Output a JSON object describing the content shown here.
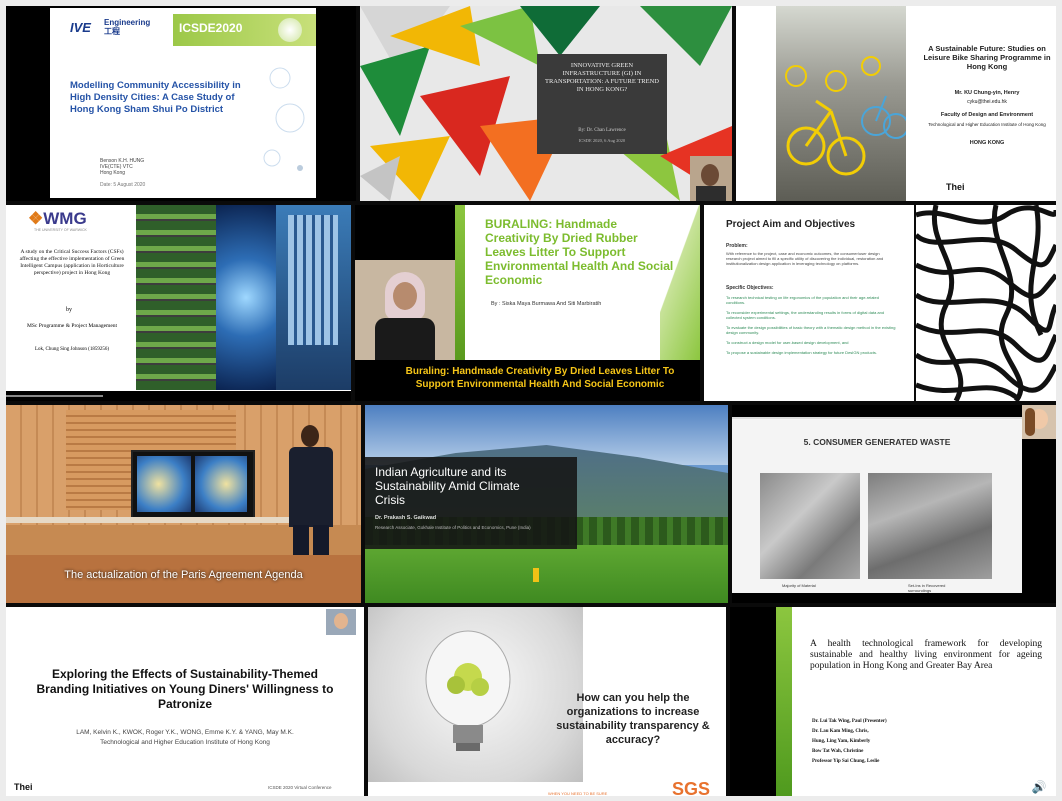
{
  "tiles": {
    "t1": {
      "logo_ive": "IVE",
      "logo_eng": "Engineering",
      "logo_sub": "工程",
      "banner": "ICSDE2020",
      "title": "Modelling Community Accessibility in High Density Cities: A Case Study of Hong Kong Sham Shui Po District",
      "author_lines": [
        "Benson K.H. HUNG",
        "IVE(CTE) VTC",
        "Hong Kong"
      ],
      "date": "Date: 5 August 2020"
    },
    "t2": {
      "title": "INNOVATIVE GREEN INFRASTRUCTURE (GI) IN TRANSPORTATION: A FUTURE TREND IN HONG KONG?",
      "byline": "By: Dr. Chan Lawrence",
      "date": "ICSDE 2020, 6 Aug 2020"
    },
    "t3": {
      "title": "A Sustainable Future: Studies on Leisure Bike Sharing Programme in Hong Kong",
      "author": "Mr. KU Chung-yin, Henry",
      "email": "cyku@thei.edu.hk",
      "faculty": "Faculty of Design and Environment",
      "institute": "Technological and Higher Education Institute of Hong Kong",
      "place": "HONG KONG",
      "logo": "Thei"
    },
    "t4": {
      "logo": "WMG",
      "logo_sub": "THE UNIVERSITY OF WARWICK",
      "title": "A study on the Critical Success Factors (CSFs) affecting the effective implementation of Green Intelligent Campus (application in Horticulture perspective) project in Hong Kong",
      "by": "by",
      "programme": "MSc Programme & Project Management",
      "student": "Lok, Chung Sing Johnson (1859256)"
    },
    "t5": {
      "title": "BURALING: Handmade Creativity By Dried Rubber Leaves Litter To Support Environmental Health And Social Economic",
      "authors": "By : Siska Maya Burmawa And Siti Marbiratih",
      "caption": "Buraling: Handmade Creativity By Dried Leaves Litter To Support Environmental Health And Social Economic"
    },
    "t6": {
      "title": "Project Aim and Objectives",
      "aim_head": "Problem:",
      "aim_text": "With reference to the project, case and economic outcomes, the consumer/user design research project aimed to fill a specific utility of discovering the individual, restoration and institutionalization design application in leveraging technology on platforms.",
      "obj_head": "Specific Objectives:",
      "objectives": [
        "To research technical testing on life ergonomics of the population and their age-related conditions.",
        "To reconsider experimental settings, the understanding results in forms of digital data and collected system conditions.",
        "To evaluate the design possibilities of basic theory with a thematic design method in the existing design community.",
        "To construct a design model for user-based design development, and",
        "To propose a sustainable design implementation strategy for future DesIGN products."
      ]
    },
    "t8": {
      "caption": "The actualization of the Paris Agreement Agenda"
    },
    "t9": {
      "title": "Indian Agriculture and its Sustainability Amid Climate Crisis",
      "author": "Dr. Prakash S. Gaikwad",
      "affil": "Research Associate, Gokhale Institute of Politics and Economics, Pune (India)"
    },
    "t10": {
      "heading": "5. CONSUMER GENERATED WASTE",
      "cap_left": "Majority of Material",
      "cap_right": "Set-Ins in Recovered surroundings"
    },
    "t11": {
      "title": "Exploring the Effects of Sustainability-Themed Branding Initiatives on Young Diners' Willingness to Patronize",
      "authors": "LAM, Kelvin K., KWOK, Roger Y.K., WONG, Emme K.Y. & YANG, May M.K.",
      "affil": "Technological and Higher Education Institute of Hong Kong",
      "logo": "Thei",
      "footer": "ICSDE 2020 Virtual Conference"
    },
    "t12": {
      "question": "How can you help the organizations to increase sustainability transparency & accuracy?",
      "footer": "WHEN YOU NEED TO BE SURE",
      "logo": "SGS"
    },
    "t13": {
      "title": "A health technological framework for developing sustainable and healthy living environment for ageing population in Hong Kong and Greater Bay Area",
      "authors": [
        "Dr. Lui Tak Wing, Paul (Presenter)",
        "Dr. Lau Kam Ming, Chris,",
        "Hung, Ling Yam, Kimberly",
        "Bow Tat Wah, Christine",
        "Professor Yip Sai Chung, Leslie"
      ]
    }
  },
  "colors": {
    "lime": "#8cc63f",
    "gold": "#f5c518",
    "frame": "#ececec"
  },
  "icons": {
    "volume": "speaker-icon",
    "camera": "video-controls"
  }
}
